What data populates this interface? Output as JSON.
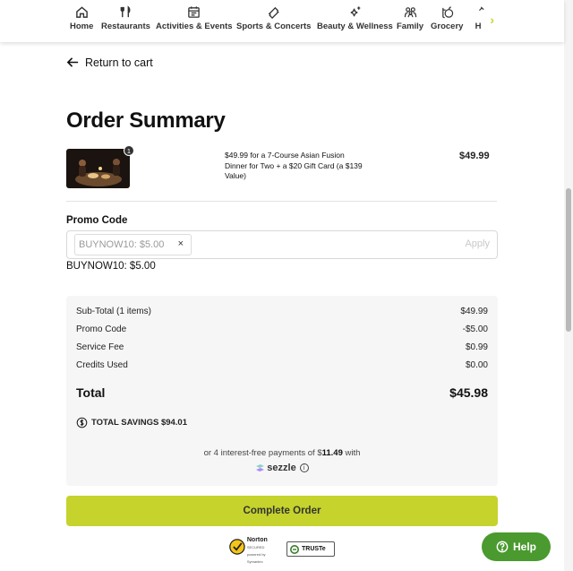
{
  "nav": {
    "items": [
      {
        "label": "Home",
        "icon": "home-icon"
      },
      {
        "label": "Restaurants",
        "icon": "fork-knife-icon"
      },
      {
        "label": "Activities & Events",
        "icon": "calendar-icon"
      },
      {
        "label": "Sports & Concerts",
        "icon": "ticket-icon"
      },
      {
        "label": "Beauty & Wellness",
        "icon": "sparkle-icon"
      },
      {
        "label": "Family",
        "icon": "family-icon"
      },
      {
        "label": "Grocery",
        "icon": "grocery-icon"
      },
      {
        "label": "H",
        "icon": "partial-icon"
      }
    ],
    "more_icon": "chevron-right-icon"
  },
  "return_link": "Return to cart",
  "page_title": "Order Summary",
  "cart_item": {
    "quantity": "1",
    "description": "$49.99 for a 7-Course Asian Fusion Dinner for Two + a $20 Gift Card (a $139 Value)",
    "price": "$49.99"
  },
  "promo": {
    "label": "Promo Code",
    "chip_text": "BUYNOW10: $5.00",
    "remove_symbol": "×",
    "apply_label": "Apply",
    "applied_text": "BUYNOW10: $5.00"
  },
  "summary": {
    "rows": [
      {
        "label": "Sub-Total (1 items)",
        "value": "$49.99"
      },
      {
        "label": "Promo Code",
        "value": "-$5.00"
      },
      {
        "label": "Service Fee",
        "value": "$0.99"
      },
      {
        "label": "Credits Used",
        "value": "$0.00"
      }
    ],
    "total_label": "Total",
    "total_value": "$45.98",
    "savings": "TOTAL SAVINGS $94.01",
    "sezzle_prefix": "or 4 interest-free payments of $",
    "sezzle_amount": "11.49",
    "sezzle_suffix": " with",
    "sezzle_brand": "sezzle",
    "info_symbol": "i"
  },
  "complete_order_label": "Complete Order",
  "badges": {
    "norton": "Norton",
    "norton_sub1": "SECURED",
    "norton_sub2": "powered by Symantec",
    "truste": "TRUSTe"
  },
  "help_label": "Help",
  "colors": {
    "accent": "#c5d32c",
    "help": "#4a9a2f"
  }
}
